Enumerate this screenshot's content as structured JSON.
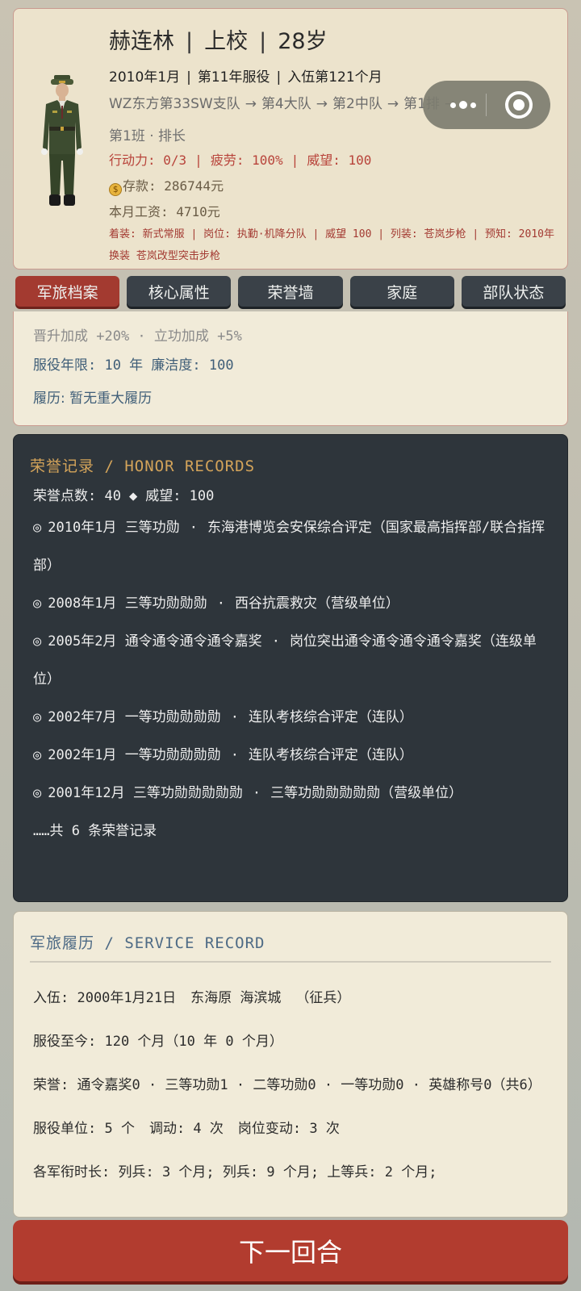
{
  "profile": {
    "name": "赫连林",
    "rank": "上校",
    "age": "28岁",
    "date": "2010年1月",
    "service_year": "第11年服役",
    "enlist_month": "入伍第121个月",
    "unit_path": [
      "WZ东方第33SW支队",
      "第4大队",
      "第2中队",
      "第1排"
    ],
    "arrow": "→",
    "squad_role": "第1班 · 排长",
    "stats": [
      "行动力: 0/3",
      "疲劳: 100%",
      "威望: 100"
    ],
    "savings": "存款: 286744元",
    "wage": "本月工资: 4710元",
    "equipment": "着装: 新式常服 | 岗位: 执勤·机降分队 | 威望 100 | 列装: 苍岚步枪 | 预知: 2010年换装 苍岚改型突击步枪",
    "coin_icon": "money-bag-icon",
    "avatar_icon": "soldier-avatar-icon"
  },
  "tabs": [
    "军旅档案",
    "核心属性",
    "荣誉墙",
    "家庭",
    "部队状态"
  ],
  "archive": {
    "bonus": "晋升加成 +20% · 立功加成 +5%",
    "years": "服役年限: 10 年  廉洁度: 100",
    "resume": "履历: 暂无重大履历"
  },
  "honor": {
    "title": "荣誉记录 / HONOR RECORDS",
    "points_label": "荣誉点数: 40",
    "prestige_label": "威望: 100",
    "diamond": "◆",
    "ring": "◎",
    "sep": "·",
    "records": [
      {
        "date": "2010年1月",
        "award": "三等功勋",
        "event": "东海港博览会安保综合评定（国家最高指挥部/联合指挥部）"
      },
      {
        "date": "2008年1月",
        "award": "三等功勋勋勋",
        "event": "西谷抗震救灾（营级单位）"
      },
      {
        "date": "2005年2月",
        "award": "通令通令通令通令嘉奖",
        "event": "岗位突出通令通令通令通令嘉奖（连级单位）"
      },
      {
        "date": "2002年7月",
        "award": "一等功勋勋勋勋",
        "event": "连队考核综合评定（连队）"
      },
      {
        "date": "2002年1月",
        "award": "一等功勋勋勋勋",
        "event": "连队考核综合评定（连队）"
      },
      {
        "date": "2001年12月",
        "award": "三等功勋勋勋勋勋",
        "event": "三等功勋勋勋勋勋（营级单位）"
      }
    ],
    "more": "……共 6 条荣誉记录"
  },
  "service": {
    "title": "军旅履历 / SERVICE RECORD",
    "enlist": "入伍: 2000年1月21日",
    "origin": "东海原 海滨城",
    "draft": "（征兵）",
    "duration": "服役至今: 120 个月（10 年 0 个月）",
    "honors": "荣誉: 通令嘉奖0 · 三等功勋1 · 二等功勋0 · 一等功勋0 · 英雄称号0（共6）",
    "units": "服役单位: 5 个",
    "transfers": "调动: 4 次",
    "post_changes": "岗位变动: 3 次",
    "rank_time": "各军衔时长: 列兵: 3 个月; 列兵: 9 个月; 上等兵: 2 个月;"
  },
  "next_button": "下一回合",
  "capsule": {
    "more_icon": "more-dots-icon",
    "close_icon": "target-close-icon"
  },
  "colors": {
    "accent_red": "#a33a30",
    "dark_panel": "#2e353b",
    "honor_gold": "#d4a45a",
    "link_blue": "#3f5e78"
  }
}
